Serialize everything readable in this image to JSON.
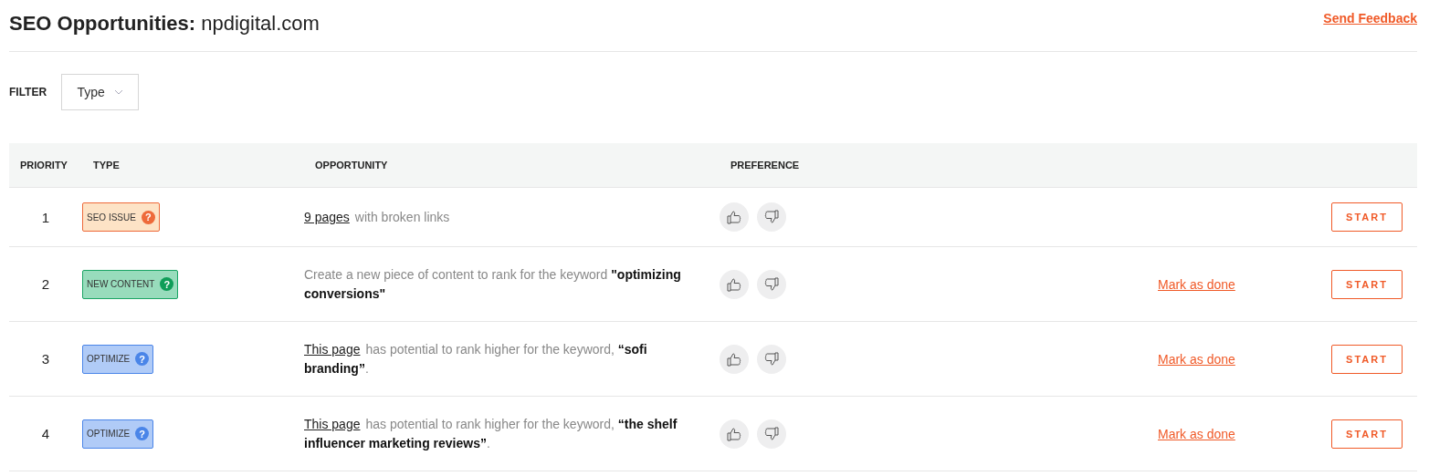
{
  "header": {
    "title": "SEO Opportunities:",
    "domain": "npdigital.com",
    "feedback_link": "Send Feedback"
  },
  "filter": {
    "label": "FILTER",
    "dropdown": "Type"
  },
  "table": {
    "columns": [
      "PRIORITY",
      "TYPE",
      "OPPORTUNITY",
      "PREFERENCE"
    ],
    "rows": [
      {
        "priority": "1",
        "type": {
          "label": "SEO ISSUE",
          "kind": "issue",
          "hint": "?"
        },
        "opportunity": {
          "link": "9 pages",
          "text": "with broken links"
        },
        "mark_done": null,
        "action": "START"
      },
      {
        "priority": "2",
        "type": {
          "label": "NEW CONTENT",
          "kind": "content",
          "hint": "?"
        },
        "opportunity": {
          "text": "Create a new piece of content to rank for the keyword **\"optimizing conversions\"**"
        },
        "mark_done": "Mark as done",
        "action": "START"
      },
      {
        "priority": "3",
        "type": {
          "label": "OPTIMIZE",
          "kind": "optimize",
          "hint": "?"
        },
        "opportunity": {
          "link": "This page",
          "text": "has potential to rank higher for the keyword, **“sofi branding”**."
        },
        "mark_done": "Mark as done",
        "action": "START"
      },
      {
        "priority": "4",
        "type": {
          "label": "OPTIMIZE",
          "kind": "optimize",
          "hint": "?"
        },
        "opportunity": {
          "link": "This page",
          "text": "has potential to rank higher for the keyword, **“the shelf influencer marketing reviews”**."
        },
        "mark_done": "Mark as done",
        "action": "START"
      }
    ]
  }
}
